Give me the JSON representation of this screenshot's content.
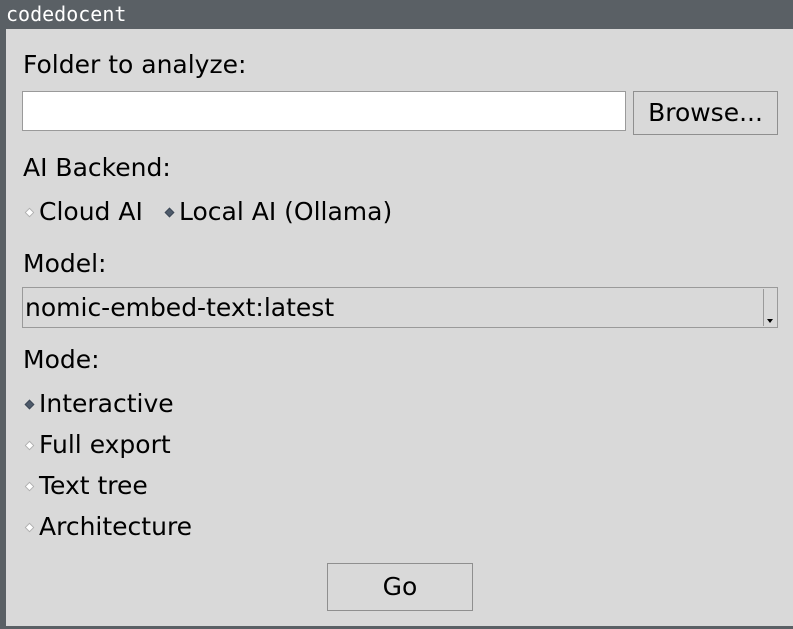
{
  "window": {
    "title": "codedocent"
  },
  "folder": {
    "label": "Folder to analyze:",
    "value": "",
    "browse_label": "Browse..."
  },
  "backend": {
    "label": "AI Backend:",
    "options": [
      {
        "label": "Cloud AI",
        "selected": false
      },
      {
        "label": "Local AI (Ollama)",
        "selected": true
      }
    ]
  },
  "model": {
    "label": "Model:",
    "selected": "nomic-embed-text:latest"
  },
  "mode": {
    "label": "Mode:",
    "options": [
      {
        "label": "Interactive",
        "selected": true
      },
      {
        "label": "Full export",
        "selected": false
      },
      {
        "label": "Text tree",
        "selected": false
      },
      {
        "label": "Architecture",
        "selected": false
      }
    ]
  },
  "actions": {
    "go_label": "Go"
  },
  "colors": {
    "background": "#d9d9d9",
    "titlebar": "#5a6065",
    "radio_selected": "#4e5b6b"
  }
}
